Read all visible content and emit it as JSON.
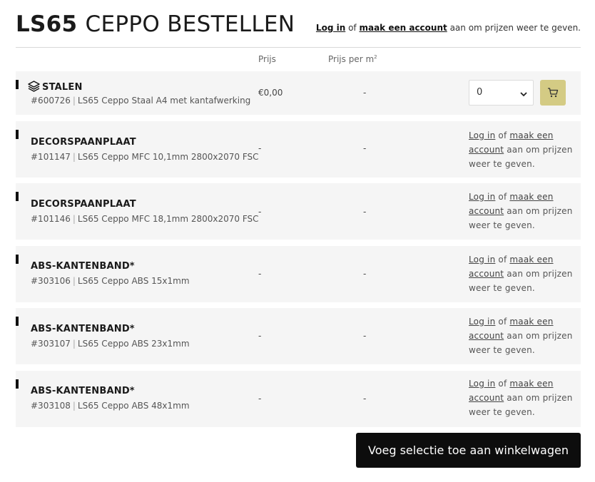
{
  "header": {
    "title_bold": "LS65",
    "title_light": "CEPPO BESTELLEN",
    "login_link": "Log in",
    "of": "of",
    "account_link": "maak een account",
    "login_suffix": "aan om prijzen weer te geven."
  },
  "columns": {
    "price": "Prijs",
    "price_per_m2": "Prijs per m",
    "price_per_m2_sup": "2"
  },
  "rows": [
    {
      "name": "STALEN",
      "icon": "layers-icon",
      "sku": "#600726",
      "desc": "LS65 Ceppo Staal A4 met kantafwerking",
      "price": "€0,00",
      "price_per_m2": "-",
      "quantity": "0"
    },
    {
      "name": "DECORSPAANPLAAT",
      "sku": "#101147",
      "desc": "LS65 Ceppo MFC 10,1mm 2800x2070 FSC",
      "price": "-",
      "price_per_m2": "-",
      "login": "Log in",
      "of": "of",
      "account": "maak een account",
      "suffix": "aan om prijzen weer te geven."
    },
    {
      "name": "DECORSPAANPLAAT",
      "sku": "#101146",
      "desc": "LS65 Ceppo MFC 18,1mm 2800x2070 FSC",
      "price": "-",
      "price_per_m2": "-",
      "login": "Log in",
      "of": "of",
      "account": "maak een account",
      "suffix": "aan om prijzen weer te geven."
    },
    {
      "name": "ABS-KANTENBAND*",
      "sku": "#303106",
      "desc": "LS65 Ceppo ABS 15x1mm",
      "price": "-",
      "price_per_m2": "-",
      "login": "Log in",
      "of": "of",
      "account": "maak een account",
      "suffix": "aan om prijzen weer te geven."
    },
    {
      "name": "ABS-KANTENBAND*",
      "sku": "#303107",
      "desc": "LS65 Ceppo ABS 23x1mm",
      "price": "-",
      "price_per_m2": "-",
      "login": "Log in",
      "of": "of",
      "account": "maak een account",
      "suffix": "aan om prijzen weer te geven."
    },
    {
      "name": "ABS-KANTENBAND*",
      "sku": "#303108",
      "desc": "LS65 Ceppo ABS 48x1mm",
      "price": "-",
      "price_per_m2": "-",
      "login": "Log in",
      "of": "of",
      "account": "maak een account",
      "suffix": "aan om prijzen weer te geven."
    }
  ],
  "add_button": "Voeg selectie toe aan winkelwagen",
  "colors": {
    "cart_button": "#d4cb84",
    "row_background": "#f5f5f5",
    "primary_button": "#0d0d0d"
  }
}
